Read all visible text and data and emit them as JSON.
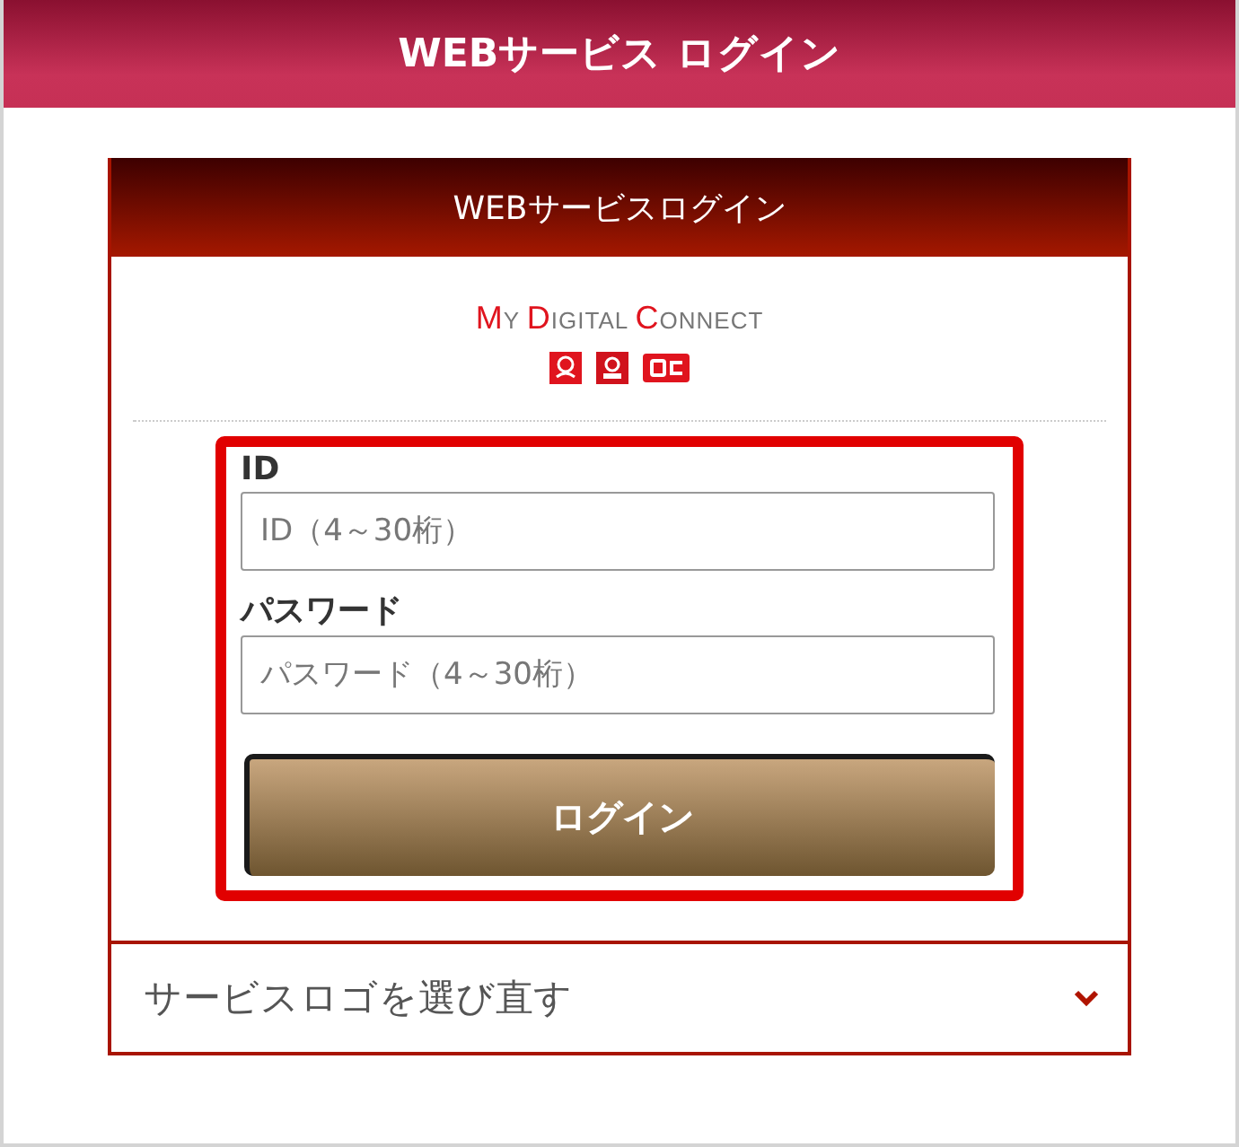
{
  "header": {
    "title": "WEBサービス ログイン"
  },
  "panel": {
    "title": "WEBサービスログイン",
    "logo_text": "MY DIGITAL CONNECT"
  },
  "form": {
    "fields": [
      {
        "label": "ID",
        "placeholder": "ID（4～30桁）"
      },
      {
        "label": "パスワード",
        "placeholder": "パスワード（4～30桁）"
      }
    ],
    "button": "ログイン"
  },
  "reselect": {
    "label": "サービスロゴを選び直す",
    "expanded": false
  }
}
